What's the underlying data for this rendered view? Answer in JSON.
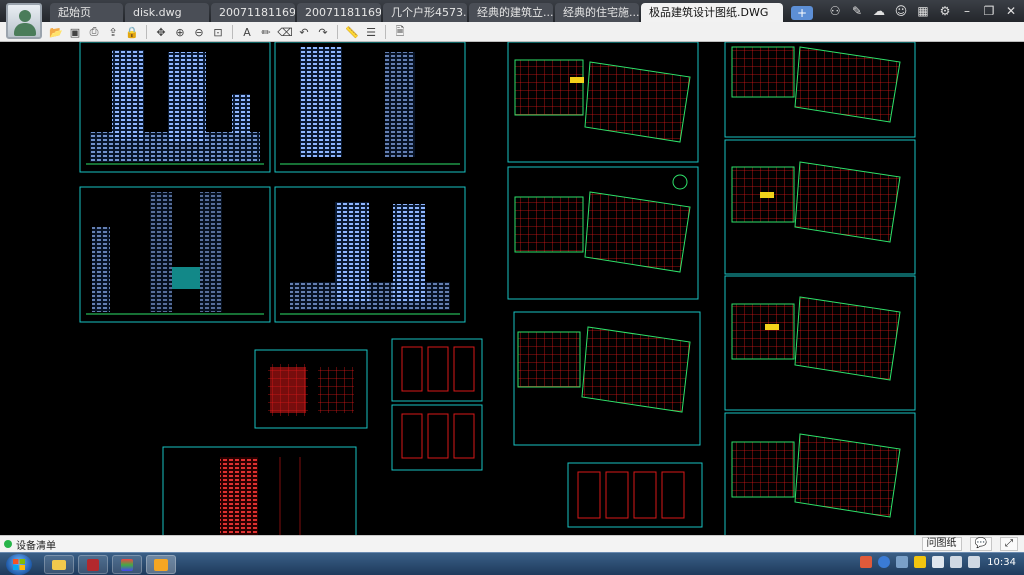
{
  "tabs": [
    {
      "label": "起始页",
      "active": false
    },
    {
      "label": "disk.dwg",
      "active": false
    },
    {
      "label": "20071181169...",
      "active": false
    },
    {
      "label": "20071181169...",
      "active": false
    },
    {
      "label": "几个户形4573...",
      "active": false
    },
    {
      "label": "经典的建筑立...",
      "active": false
    },
    {
      "label": "经典的住宅施...",
      "active": false
    },
    {
      "label": "极品建筑设计图纸.DWG",
      "active": true
    }
  ],
  "new_tab_label": "+",
  "window_controls": [
    "share-icon",
    "edit-icon",
    "cloud-icon",
    "user-icon",
    "grid-icon",
    "gear-icon",
    "minimize-icon",
    "restore-icon",
    "close-icon"
  ],
  "toolbar_icons": [
    "open-icon",
    "save-icon",
    "print-icon",
    "export-icon",
    "lock-icon",
    "pan-icon",
    "zoom-in-icon",
    "zoom-out-icon",
    "zoom-extents-icon",
    "text-icon",
    "pencil-icon",
    "eraser-icon",
    "undo-icon",
    "redo-icon",
    "measure-icon",
    "layers-icon",
    "properties-icon"
  ],
  "status": {
    "label": "设备清单",
    "ask_button": "问图纸",
    "dot_color": "#27b54a"
  },
  "taskbar": {
    "time": "10:34",
    "items": [
      "explorer-icon",
      "cad-app-icon",
      "archive-icon",
      "paint-icon"
    ]
  },
  "colors": {
    "frame": "#19c2c2",
    "building_blue": "#8fb6ff",
    "plan_red": "#d81818",
    "plan_green": "#2ee26a",
    "plan_yellow": "#f2d21a"
  }
}
